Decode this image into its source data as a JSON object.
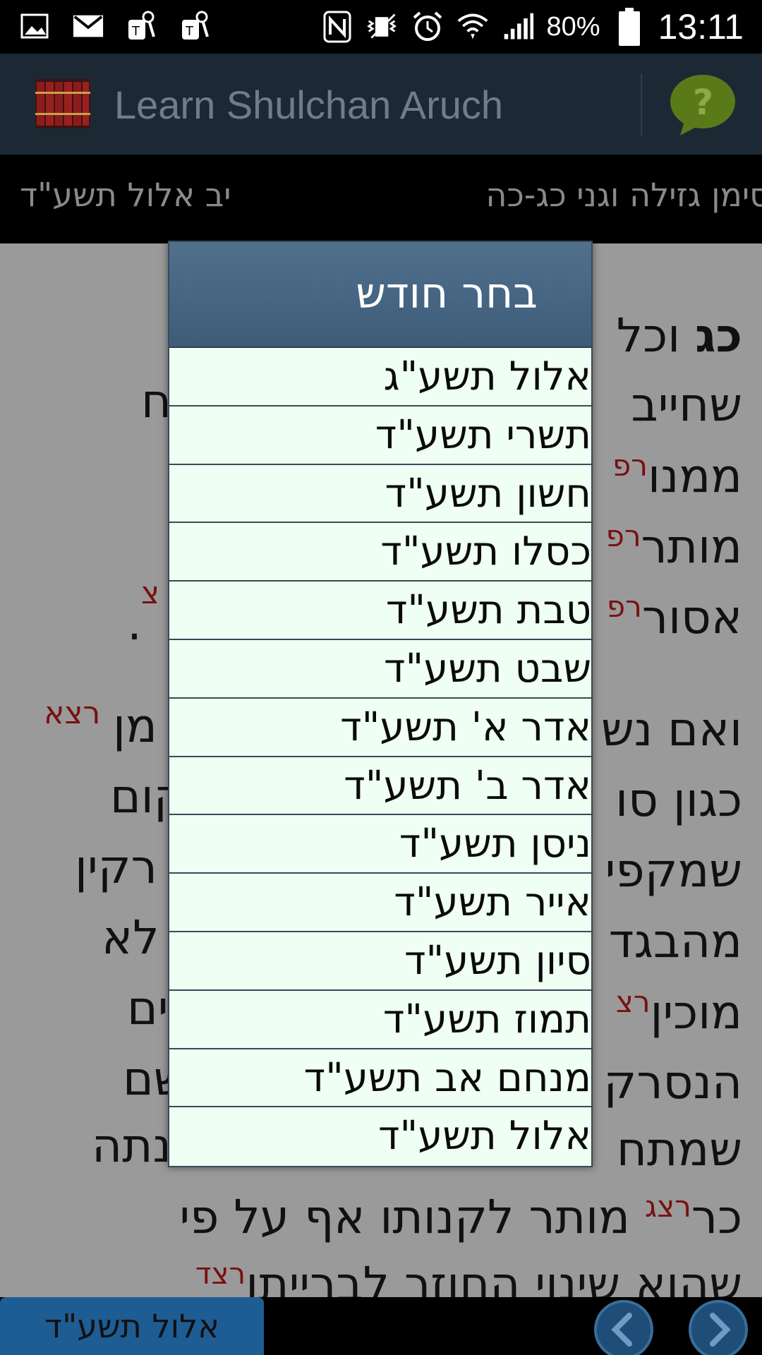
{
  "status_bar": {
    "battery_percent": "80%",
    "time": "13:11",
    "icons": [
      "gallery-icon",
      "gmail-icon",
      "t-mobile-icon",
      "t-mobile-icon",
      "nfc-icon",
      "vibrate-icon",
      "alarm-icon",
      "wifi-icon",
      "signal-icon",
      "battery-icon"
    ]
  },
  "action_bar": {
    "title": "Learn Shulchan Aruch",
    "logo_icon": "books-icon",
    "help_icon": "help-bubble-icon"
  },
  "info_strip": {
    "section": "סימן גזילה וגני כג-כה",
    "date": "יב אלול תשע\"ד"
  },
  "background_text": {
    "lines": [
      {
        "text": "וכל",
        "bold_prefix": "כג",
        "note": ""
      },
      {
        "text": "שחייב",
        "note": ""
      },
      {
        "text": "ממנו",
        "note": "רפ"
      },
      {
        "text": "מותר",
        "note": "רפ"
      },
      {
        "text": "אסור",
        "note": "רפ"
      },
      {
        "text": "",
        "note": ""
      },
      {
        "text": "ואם נש",
        "note": ""
      },
      {
        "text": "כגון סו",
        "note": ""
      },
      {
        "text": "שמקפי",
        "note": ""
      },
      {
        "text": "מהבגד",
        "note": ""
      },
      {
        "text": "מוכין",
        "note": "רצ"
      },
      {
        "text": "הנסרק",
        "note": ""
      },
      {
        "text": "שמתח",
        "note": ""
      },
      {
        "text": "כר",
        "note": "רצג",
        "tail": "מותר לקנותו אף על פי"
      },
      {
        "text": "שהוא שינוי החוזר לברייתו",
        "note": "רצד"
      }
    ],
    "left_fragments": [
      "ח",
      "צ",
      ".",
      "מן",
      "רצא",
      "קום",
      "רקין",
      "לא",
      "ים",
      "שם",
      "נתה"
    ]
  },
  "dialog": {
    "title": "בחר חודש",
    "months": [
      "אלול תשע\"ג",
      "תשרי תשע\"ד",
      "חשון תשע\"ד",
      "כסלו תשע\"ד",
      "טבת תשע\"ד",
      "שבט תשע\"ד",
      "אדר א' תשע\"ד",
      "אדר ב' תשע\"ד",
      "ניסן תשע\"ד",
      "אייר תשע\"ד",
      "סיון תשע\"ד",
      "תמוז תשע\"ד",
      "מנחם אב תשע\"ד",
      "אלול תשע\"ד"
    ]
  },
  "bottom_bar": {
    "month_button_label": "אלול תשע\"ד",
    "prev_icon": "chevron-left-icon",
    "next_icon": "chevron-right-icon"
  },
  "colors": {
    "action_bar_bg": "#1c2935",
    "dialog_header": "#4a6a88",
    "dialog_bg": "#f0fff3",
    "note_red": "#7a1010",
    "month_button": "#1e5c94"
  }
}
